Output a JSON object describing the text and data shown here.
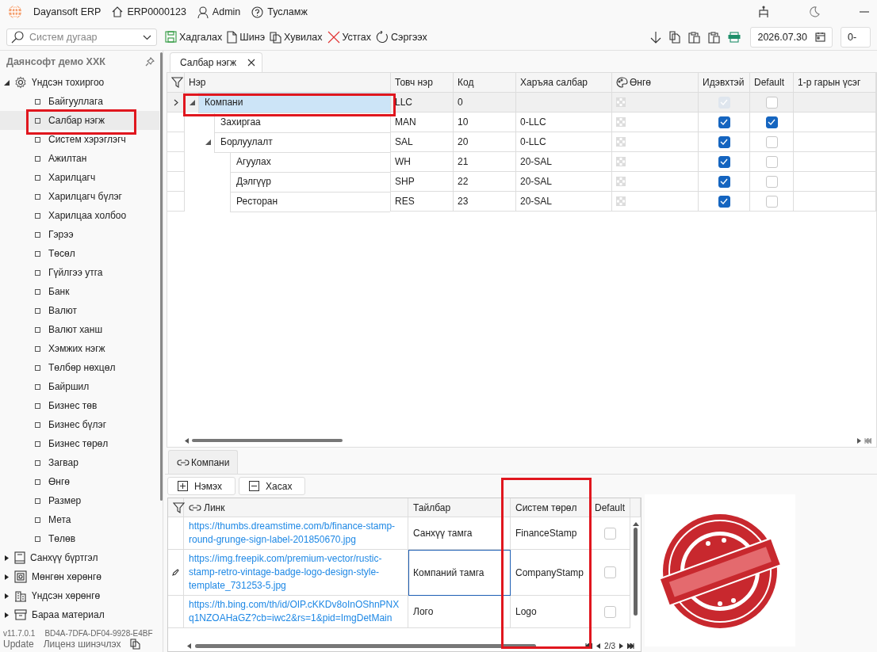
{
  "app": {
    "title": "Dayansoft ERP",
    "database": "ERP0000123",
    "user": "Admin",
    "help": "Тусламж"
  },
  "toolbar": {
    "search": {
      "placeholder": "Систем дугаар"
    },
    "actions": [
      {
        "label": "Хадгалах",
        "kind": "save"
      },
      {
        "label": "Шинэ",
        "kind": "new"
      },
      {
        "label": "Хувилах",
        "kind": "copy"
      },
      {
        "label": "Устгах",
        "kind": "delete"
      },
      {
        "label": "Сэргээх",
        "kind": "refresh"
      }
    ],
    "date": "2026.07.30",
    "period": "0-"
  },
  "sidebar": {
    "company": "Даянсофт демо ХХК",
    "tree": [
      {
        "label": "Үндсэн тохиргоо",
        "kind": "gear",
        "expanded": true,
        "children": [
          {
            "label": "Байгууллага",
            "selected": false
          },
          {
            "label": "Салбар нэгж",
            "selected": true
          },
          {
            "label": "Систем хэрэглэгч",
            "selected": false
          },
          {
            "label": "Ажилтан",
            "selected": false
          },
          {
            "label": "Харилцагч",
            "selected": false
          },
          {
            "label": "Харилцагч бүлэг",
            "selected": false
          },
          {
            "label": "Харилцаа холбоо",
            "selected": false
          },
          {
            "label": "Гэрээ",
            "selected": false
          },
          {
            "label": "Төсөл",
            "selected": false
          },
          {
            "label": "Гүйлгээ утга",
            "selected": false
          },
          {
            "label": "Банк",
            "selected": false
          },
          {
            "label": "Валют",
            "selected": false
          },
          {
            "label": "Валют ханш",
            "selected": false
          },
          {
            "label": "Хэмжих нэгж",
            "selected": false
          },
          {
            "label": "Төлбөр нөхцөл",
            "selected": false
          },
          {
            "label": "Байршил",
            "selected": false
          },
          {
            "label": "Бизнес төв",
            "selected": false
          },
          {
            "label": "Бизнес бүлэг",
            "selected": false
          },
          {
            "label": "Бизнес төрөл",
            "selected": false
          },
          {
            "label": "Загвар",
            "selected": false
          },
          {
            "label": "Өнгө",
            "selected": false
          },
          {
            "label": "Размер",
            "selected": false
          },
          {
            "label": "Мета",
            "selected": false
          },
          {
            "label": "Төлөв",
            "selected": false
          }
        ]
      },
      {
        "label": "Санхүү бүртгэл",
        "kind": "book",
        "expanded": false
      },
      {
        "label": "Мөнгөн хөрөнгө",
        "kind": "safe",
        "expanded": false
      },
      {
        "label": "Үндсэн хөрөнгө",
        "kind": "building",
        "expanded": false
      },
      {
        "label": "Бараа материал",
        "kind": "box",
        "expanded": false
      }
    ],
    "version": "v11.7.0.1",
    "license_key": "BD4A-7DFA-DF04-9928-E4BF",
    "update": "Update",
    "renew_license": "Лиценз шинэчлэх"
  },
  "tabs": [
    {
      "label": "Салбар нэгж",
      "selected": true
    }
  ],
  "grid": {
    "columns": [
      "Нэр",
      "Товч нэр",
      "Код",
      "Харъяа салбар",
      "Өнгө",
      "Идэвхтэй",
      "Default",
      "1-р гарын үсэг"
    ],
    "rows": [
      {
        "name": "Компани",
        "short": "LLC",
        "code": "0",
        "active": true,
        "disabled": true,
        "default": false,
        "selected": true,
        "expanded": true,
        "children": [
          {
            "name": "Захиргаа",
            "short": "MAN",
            "code": "10",
            "parent": "0-LLC",
            "active": true,
            "disabled": false,
            "default": true,
            "selected": false
          },
          {
            "name": "Борлуулалт",
            "short": "SAL",
            "code": "20",
            "parent": "0-LLC",
            "active": true,
            "disabled": false,
            "default": false,
            "selected": false,
            "expanded": true,
            "children": [
              {
                "name": "Агуулах",
                "short": "WH",
                "code": "21",
                "parent": "20-SAL",
                "active": true,
                "disabled": false,
                "default": false,
                "selected": false
              },
              {
                "name": "Дэлгүүр",
                "short": "SHP",
                "code": "22",
                "parent": "20-SAL",
                "active": true,
                "disabled": false,
                "default": false,
                "selected": false
              },
              {
                "name": "Ресторан",
                "short": "RES",
                "code": "23",
                "parent": "20-SAL",
                "active": true,
                "disabled": false,
                "default": false,
                "selected": false
              }
            ]
          }
        ]
      }
    ]
  },
  "detail": {
    "tab": "Компани",
    "buttons": [
      {
        "label": "Нэмэх",
        "kind": "add"
      },
      {
        "label": "Хасах",
        "kind": "remove"
      }
    ],
    "columns": [
      "Линк",
      "Тайлбар",
      "Систем төрөл",
      "Default"
    ],
    "rows": [
      {
        "link": "https://thumbs.dreamstime.com/b/finance-stamp-round-grunge-sign-label-201850670.jpg",
        "description": "Санхүү тамга",
        "system_type": "FinanceStamp",
        "default": false,
        "editing": false
      },
      {
        "link": "https://img.freepik.com/premium-vector/rustic-stamp-retro-vintage-badge-logo-design-style-template_731253-5.jpg",
        "description": "Компаний тамга",
        "system_type": "CompanyStamp",
        "default": false,
        "editing": true
      },
      {
        "link": "https://th.bing.com/th/id/OIP.cKKDv8oInOShnPNXq1NZOAHaGZ?cb=iwc2&rs=1&pid=ImgDetMain",
        "description": "Лого",
        "system_type": "Logo",
        "default": false,
        "editing": false
      }
    ],
    "pager": "2/3",
    "preview": {
      "kind": "picture"
    }
  }
}
